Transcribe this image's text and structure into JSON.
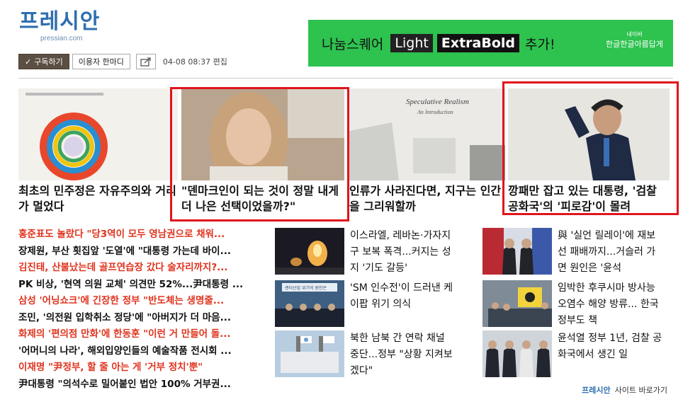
{
  "header": {
    "logo_text": "프레시안",
    "logo_sub": "pressian.com",
    "subscribe_label": "구독하기",
    "comment_label": "이용자 한마디",
    "datetime": "04-08 08:37",
    "edit_label": "편집"
  },
  "banner": {
    "text": "나눔스퀘어",
    "light": "Light",
    "bold": "ExtraBold",
    "add": "추가!",
    "brand_small": "네이버",
    "brand": "한글한글아름답게"
  },
  "cards": [
    {
      "title": "최초의 민주정은 자유주의와 거리가 멀었다",
      "image": "book-cover-colorful-ring"
    },
    {
      "title": "\"덴마크인이 되는 것이 정말 내게 더 나은 선택이었을까?\"",
      "image": "woman-portrait"
    },
    {
      "title": "인류가 사라진다면, 지구는 인간을 그리워할까",
      "image": "speculative-realism-book",
      "cover_title": "Speculative Realism",
      "cover_sub": "An Introduction"
    },
    {
      "title": "깡패만 잡고 있는 대통령, '검찰 공화국'의 '피로감'이 몰려",
      "image": "president-saluting"
    }
  ],
  "newslist": [
    {
      "text": "홍준표도 놀랐다 \"당3역이 모두 영남권으로 채워...",
      "color": "red"
    },
    {
      "text": "장제원, 부산 횟집앞 '도열'에 \"대통령 가는데 바이...",
      "color": "black"
    },
    {
      "text": "김진태, 산불났는데 골프연습장 갔다 술자리까지?...",
      "color": "red"
    },
    {
      "text": "PK 비상, '현역 의원 교체' 의견만 52%...尹대통령 ...",
      "color": "black"
    },
    {
      "text": "삼성 '어닝쇼크'에 긴장한 정부 \"반도체는 생명줄...",
      "color": "red"
    },
    {
      "text": "조민, '의전원 입학취소 정당'에 \"아버지가 더 마음...",
      "color": "black"
    },
    {
      "text": "화제의 '편의점 만화'에 한동훈 \"이런 거 만들어 돌...",
      "color": "red"
    },
    {
      "text": "'어머니의 나라', 해외입양인들의 예술작품 전시회 ...",
      "color": "black"
    },
    {
      "text": "이재명 \"尹정부, 할 줄 아는 게 '거부 정치'뿐\"",
      "color": "red"
    },
    {
      "text": "尹대통령 \"의석수로 밀어붙인 법안 100% 거부권...",
      "color": "black"
    }
  ],
  "middle": [
    {
      "text": "이스라엘, 레바논·가자지구 보복 폭격...커지는 성지 '기도 갈등'",
      "image": "night-explosion"
    },
    {
      "text": "'SM 인수전'이 드러낸 케이팝 위기 의식",
      "image": "press-conference",
      "banner_text": "엔터산업 위기의 원인은"
    },
    {
      "text": "북한 남북 간 연락 채널 중단...정부 \"상황 지켜보겠다\"",
      "image": "building-flags"
    }
  ],
  "right": [
    {
      "text": "與 '실언 릴레이'에 재보선 패배까지...거슬러 가면 원인은 '윤석",
      "image": "two-officials"
    },
    {
      "text": "임박한 후쿠시마 방사능 오염수 해양 방류... 한국 정부도 책",
      "image": "protest-crowd"
    },
    {
      "text": "윤석열 정부 1년, 검찰 공화국에서 생긴 일",
      "image": "officials-standing"
    }
  ],
  "footer": {
    "brand": "프레시안",
    "text": "사이트 바로가기"
  },
  "colors": {
    "accent_red": "#e0331e",
    "logo_blue": "#2e6fb0",
    "banner_green": "#2ec24f",
    "highlight_box": "#e1141c"
  }
}
